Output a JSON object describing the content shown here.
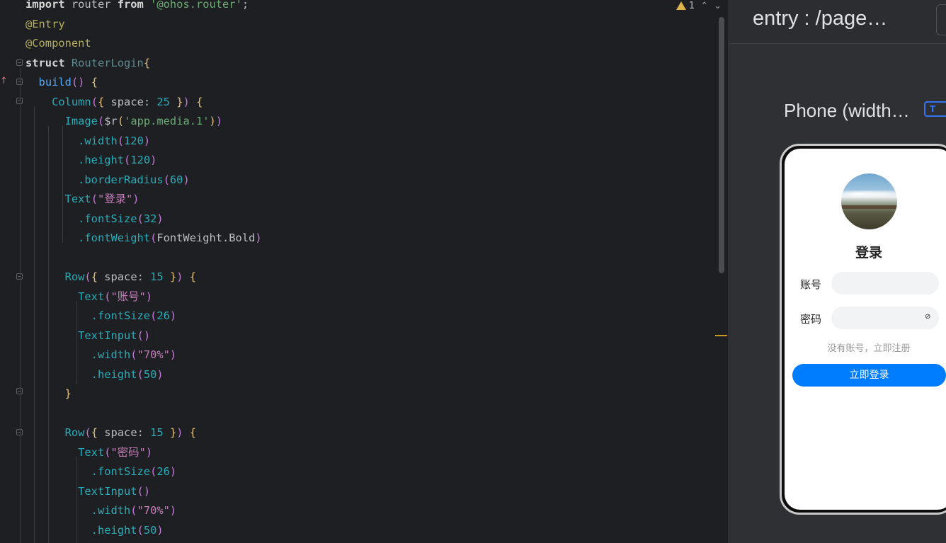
{
  "editor": {
    "inspection": {
      "warning_count": "1"
    },
    "lines": [
      [
        [
          "kwb",
          "import"
        ],
        [
          "id",
          " router "
        ],
        [
          "kwb",
          "from"
        ],
        [
          "id",
          " "
        ],
        [
          "str",
          "'@ohos.router'"
        ],
        [
          "id",
          ";"
        ]
      ],
      [
        [
          "ann",
          "@Entry"
        ]
      ],
      [
        [
          "ann",
          "@Component"
        ]
      ],
      [
        [
          "kwb",
          "struct"
        ],
        [
          "id",
          " "
        ],
        [
          "cls",
          "RouterLogin"
        ],
        [
          "br1",
          "{"
        ]
      ],
      [
        [
          "id",
          "  "
        ],
        [
          "fn",
          "build"
        ],
        [
          "br2",
          "()"
        ],
        [
          "id",
          " "
        ],
        [
          "br1",
          "{"
        ]
      ],
      [
        [
          "id",
          "    "
        ],
        [
          "meth",
          "Column"
        ],
        [
          "br2",
          "("
        ],
        [
          "br1",
          "{"
        ],
        [
          "id",
          " space: "
        ],
        [
          "num",
          "25"
        ],
        [
          "id",
          " "
        ],
        [
          "br1",
          "}"
        ],
        [
          "br2",
          ")"
        ],
        [
          "id",
          " "
        ],
        [
          "br1",
          "{"
        ]
      ],
      [
        [
          "id",
          "      "
        ],
        [
          "meth",
          "Image"
        ],
        [
          "br2",
          "("
        ],
        [
          "id",
          "$r"
        ],
        [
          "br1",
          "("
        ],
        [
          "str",
          "'app.media.1'"
        ],
        [
          "br1",
          ")"
        ],
        [
          "br2",
          ")"
        ]
      ],
      [
        [
          "id",
          "        "
        ],
        [
          "meth",
          ".width"
        ],
        [
          "br2",
          "("
        ],
        [
          "num",
          "120"
        ],
        [
          "br2",
          ")"
        ]
      ],
      [
        [
          "id",
          "        "
        ],
        [
          "meth",
          ".height"
        ],
        [
          "br2",
          "("
        ],
        [
          "num",
          "120"
        ],
        [
          "br2",
          ")"
        ]
      ],
      [
        [
          "id",
          "        "
        ],
        [
          "meth",
          ".borderRadius"
        ],
        [
          "br2",
          "("
        ],
        [
          "num",
          "60"
        ],
        [
          "br2",
          ")"
        ]
      ],
      [
        [
          "id",
          "      "
        ],
        [
          "meth",
          "Text"
        ],
        [
          "br2",
          "("
        ],
        [
          "strv",
          "\"登录\""
        ],
        [
          "br2",
          ")"
        ]
      ],
      [
        [
          "id",
          "        "
        ],
        [
          "meth",
          ".fontSize"
        ],
        [
          "br2",
          "("
        ],
        [
          "num",
          "32"
        ],
        [
          "br2",
          ")"
        ]
      ],
      [
        [
          "id",
          "        "
        ],
        [
          "meth",
          ".fontWeight"
        ],
        [
          "br2",
          "("
        ],
        [
          "id",
          "FontWeight.Bold"
        ],
        [
          "br2",
          ")"
        ]
      ],
      [],
      [
        [
          "id",
          "      "
        ],
        [
          "meth",
          "Row"
        ],
        [
          "br2",
          "("
        ],
        [
          "br1",
          "{"
        ],
        [
          "id",
          " space: "
        ],
        [
          "num",
          "15"
        ],
        [
          "id",
          " "
        ],
        [
          "br1",
          "}"
        ],
        [
          "br2",
          ")"
        ],
        [
          "id",
          " "
        ],
        [
          "br1",
          "{"
        ]
      ],
      [
        [
          "id",
          "        "
        ],
        [
          "meth",
          "Text"
        ],
        [
          "br2",
          "("
        ],
        [
          "strv",
          "\"账号\""
        ],
        [
          "br2",
          ")"
        ]
      ],
      [
        [
          "id",
          "          "
        ],
        [
          "meth",
          ".fontSize"
        ],
        [
          "br2",
          "("
        ],
        [
          "num",
          "26"
        ],
        [
          "br2",
          ")"
        ]
      ],
      [
        [
          "id",
          "        "
        ],
        [
          "meth",
          "TextInput"
        ],
        [
          "br2",
          "()"
        ]
      ],
      [
        [
          "id",
          "          "
        ],
        [
          "meth",
          ".width"
        ],
        [
          "br2",
          "("
        ],
        [
          "strv",
          "\"70%\""
        ],
        [
          "br2",
          ")"
        ]
      ],
      [
        [
          "id",
          "          "
        ],
        [
          "meth",
          ".height"
        ],
        [
          "br2",
          "("
        ],
        [
          "num",
          "50"
        ],
        [
          "br2",
          ")"
        ]
      ],
      [
        [
          "id",
          "      "
        ],
        [
          "br1",
          "}"
        ]
      ],
      [],
      [
        [
          "id",
          "      "
        ],
        [
          "meth",
          "Row"
        ],
        [
          "br2",
          "("
        ],
        [
          "br1",
          "{"
        ],
        [
          "id",
          " space: "
        ],
        [
          "num",
          "15"
        ],
        [
          "id",
          " "
        ],
        [
          "br1",
          "}"
        ],
        [
          "br2",
          ")"
        ],
        [
          "id",
          " "
        ],
        [
          "br1",
          "{"
        ]
      ],
      [
        [
          "id",
          "        "
        ],
        [
          "meth",
          "Text"
        ],
        [
          "br2",
          "("
        ],
        [
          "strv",
          "\"密码\""
        ],
        [
          "br2",
          ")"
        ]
      ],
      [
        [
          "id",
          "          "
        ],
        [
          "meth",
          ".fontSize"
        ],
        [
          "br2",
          "("
        ],
        [
          "num",
          "26"
        ],
        [
          "br2",
          ")"
        ]
      ],
      [
        [
          "id",
          "        "
        ],
        [
          "meth",
          "TextInput"
        ],
        [
          "br2",
          "()"
        ]
      ],
      [
        [
          "id",
          "          "
        ],
        [
          "meth",
          ".width"
        ],
        [
          "br2",
          "("
        ],
        [
          "strv",
          "\"70%\""
        ],
        [
          "br2",
          ")"
        ]
      ],
      [
        [
          "id",
          "          "
        ],
        [
          "meth",
          ".height"
        ],
        [
          "br2",
          "("
        ],
        [
          "num",
          "50"
        ],
        [
          "br2",
          ")"
        ]
      ]
    ]
  },
  "previewer": {
    "title": "entry : /page…",
    "device_name": "Phone (width…",
    "device_button_icon": "T",
    "app": {
      "avatar_icon": "avatar-image",
      "title": "登录",
      "account_label": "账号",
      "account_value": "",
      "password_label": "密码",
      "password_value": "",
      "password_icon": "eye-off-icon",
      "register_link": "没有账号，立即注册",
      "login_button": "立即登录",
      "accent_color": "#007dff"
    }
  }
}
